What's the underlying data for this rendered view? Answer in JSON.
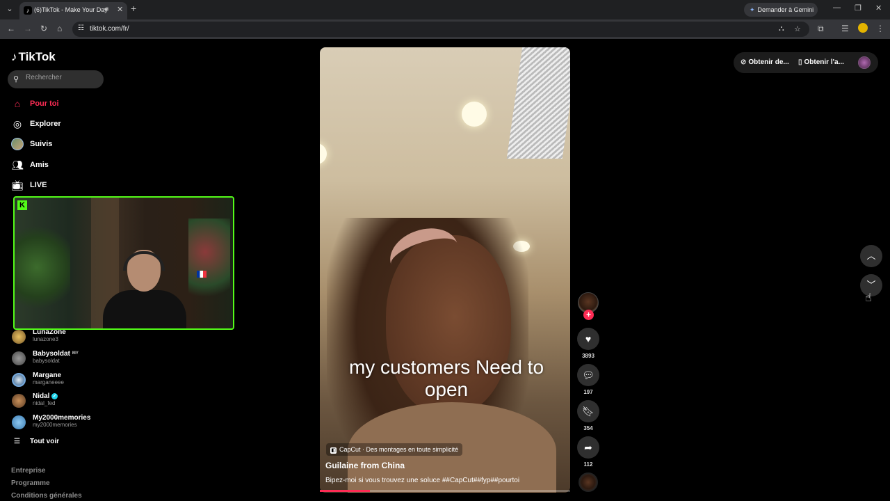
{
  "browser": {
    "tab_title": "(6)TikTok - Make Your Day",
    "new_tab_icon": "+",
    "gemini_button": "Demander à Gemini",
    "url": "tiktok.com/fr/"
  },
  "sidebar": {
    "logo": "TikTok",
    "search_placeholder": "Rechercher",
    "nav": [
      {
        "label": "Pour toi",
        "icon": "home-icon",
        "active": true
      },
      {
        "label": "Explorer",
        "icon": "compass-icon"
      },
      {
        "label": "Suivis",
        "icon": "avatar"
      },
      {
        "label": "Amis",
        "icon": "friends-icon"
      },
      {
        "label": "LIVE",
        "icon": "live-icon"
      }
    ],
    "following": [
      {
        "name": "LunaZone",
        "handle": "lunazone3"
      },
      {
        "name": "Babysoldat",
        "handle": "babysoldat",
        "tag": "MY"
      },
      {
        "name": "Margane",
        "handle": "marganeeee"
      },
      {
        "name": "Nidal",
        "handle": "nidal_fed",
        "verified": true
      },
      {
        "name": "My2000memories",
        "handle": "my2000memories"
      }
    ],
    "see_all": "Tout voir",
    "footer": [
      "Entreprise",
      "Programme",
      "Conditions générales"
    ]
  },
  "video": {
    "caption_line1": "my customers Need to",
    "caption_line2": "open",
    "capcut_label": "CapCut · Des montages en toute simplicité",
    "author": "Guilaine from China",
    "description": "Bipez-moi si vous trouvez une soluce ##CapCut##fyp##pourtoi",
    "progress_percent": 20
  },
  "actions": {
    "likes": "3893",
    "comments": "197",
    "saves": "354",
    "shares": "112"
  },
  "top_right": {
    "get_coins": "Obtenir de...",
    "get_app": "Obtenir l'a..."
  },
  "colors": {
    "accent": "#fe2c55",
    "kick_green": "#53fc18"
  }
}
